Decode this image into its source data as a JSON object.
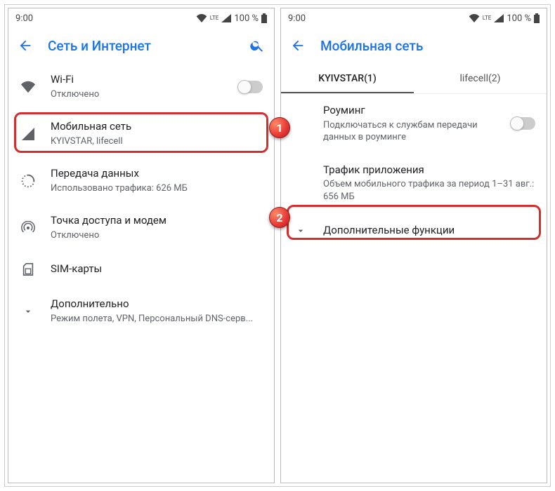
{
  "status": {
    "time": "9:00",
    "lte": "LTE",
    "battery": "100 %"
  },
  "left": {
    "title": "Сеть и Интернет",
    "items": [
      {
        "title": "Wi-Fi",
        "subtitle": "Отключено"
      },
      {
        "title": "Мобильная сеть",
        "subtitle": "KYIVSTAR, lifecell"
      },
      {
        "title": "Передача данных",
        "subtitle": "Использовано трафика: 626 МБ"
      },
      {
        "title": "Точка доступа и модем",
        "subtitle": "Отключено"
      },
      {
        "title": "SIM-карты"
      },
      {
        "title": "Дополнительно",
        "subtitle": "Режим полета, VPN, Персональный DNS-серв..."
      }
    ]
  },
  "right": {
    "title": "Мобильная сеть",
    "tabs": [
      "KYIVSTAR(1)",
      "lifecell(2)"
    ],
    "items": [
      {
        "title": "Роуминг",
        "subtitle": "Подключаться к службам передачи данных в роуминге"
      },
      {
        "title": "Трафик приложения",
        "subtitle": "Объем мобильного трафика за период 1–31 авг.: 656 МБ"
      },
      {
        "title": "Дополнительные функции"
      }
    ]
  },
  "steps": {
    "one": "1",
    "two": "2"
  }
}
